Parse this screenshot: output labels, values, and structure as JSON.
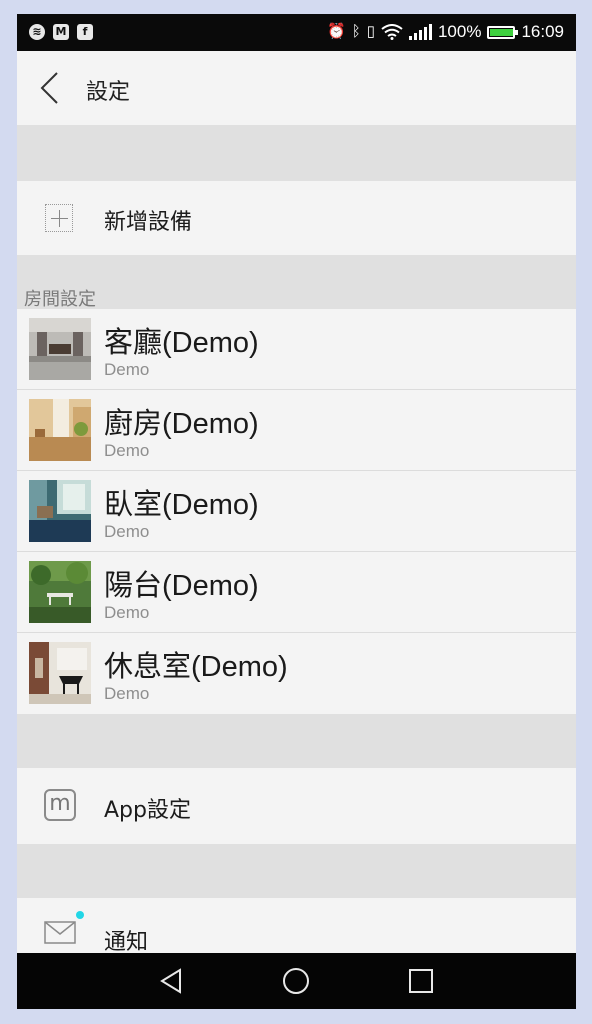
{
  "status_bar": {
    "left_icons": [
      "spotify-icon",
      "gmail-icon",
      "facebook-icon"
    ],
    "right_icons": [
      "alarm-icon",
      "bluetooth-icon",
      "vibrate-icon",
      "wifi-icon",
      "signal-icon"
    ],
    "battery_percent": "100%",
    "battery_level": 1.0,
    "time": "16:09"
  },
  "header": {
    "title": "設定",
    "back_icon": "chevron-left-icon"
  },
  "add_device": {
    "label": "新增設備",
    "icon": "plus-icon"
  },
  "rooms": {
    "section_title": "房間設定",
    "items": [
      {
        "title": "客廳(Demo)",
        "subtitle": "Demo",
        "thumb": "living-room"
      },
      {
        "title": "廚房(Demo)",
        "subtitle": "Demo",
        "thumb": "kitchen"
      },
      {
        "title": "臥室(Demo)",
        "subtitle": "Demo",
        "thumb": "bedroom"
      },
      {
        "title": "陽台(Demo)",
        "subtitle": "Demo",
        "thumb": "balcony"
      },
      {
        "title": "休息室(Demo)",
        "subtitle": "Demo",
        "thumb": "lounge"
      }
    ]
  },
  "app_settings": {
    "label": "App設定",
    "icon": "m-logo-icon"
  },
  "notifications": {
    "label": "通知",
    "icon": "mail-icon",
    "badge_color": "#22d6e6"
  },
  "nav_bar": {
    "buttons": [
      "back-triangle-icon",
      "home-circle-icon",
      "recents-square-icon"
    ]
  },
  "colors": {
    "background": "#d3daf0",
    "panel": "#f4f4f4",
    "separator": "#e0e0e0",
    "accent": "#22d6e6"
  }
}
